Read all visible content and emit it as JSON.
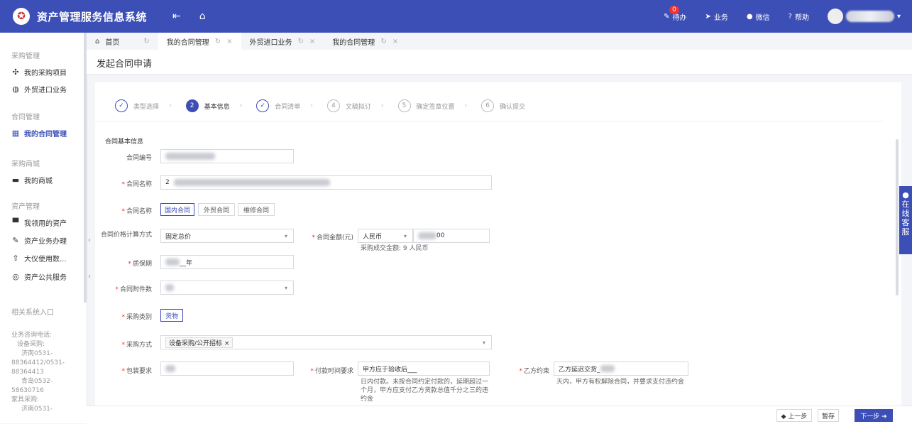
{
  "app": {
    "title": "资产管理服务信息系统"
  },
  "topbar": {
    "todo_label": "待办",
    "todo_count": "0",
    "business_label": "业务",
    "wechat_label": "微信",
    "help_label": "帮助"
  },
  "sidebar": {
    "groups": [
      {
        "label": "采购管理"
      },
      {
        "label": "合同管理"
      },
      {
        "label": "采购商城"
      },
      {
        "label": "资产管理"
      },
      {
        "label": "相关系统入口"
      }
    ],
    "items": [
      {
        "label": "我的采购项目"
      },
      {
        "label": "外贸进口业务"
      },
      {
        "label": "我的合同管理"
      },
      {
        "label": "我的商城"
      },
      {
        "label": "我领用的资产"
      },
      {
        "label": "资产业务办理"
      },
      {
        "label": "大仪使用数..."
      },
      {
        "label": "资产公共服务"
      }
    ],
    "footer_lines": [
      "业务咨询电话:",
      "设备采购:",
      "济南0531-",
      "88364412/0531-",
      "88364413",
      "青岛0532-",
      "58630716",
      "家具采购:",
      "济南0531-"
    ]
  },
  "tabs": [
    {
      "label": "首页"
    },
    {
      "label": "我的合同管理"
    },
    {
      "label": "外贸进口业务"
    },
    {
      "label": "我的合同管理"
    }
  ],
  "page": {
    "title": "发起合同申请"
  },
  "steps": [
    {
      "num": "✓",
      "label": "类型选择"
    },
    {
      "num": "2",
      "label": "基本信息"
    },
    {
      "num": "✓",
      "label": "合同清单"
    },
    {
      "num": "4",
      "label": "文稿拟订"
    },
    {
      "num": "5",
      "label": "确定签章位置"
    },
    {
      "num": "6",
      "label": "确认提交"
    }
  ],
  "form": {
    "section_title": "合同基本信息",
    "contract_no_label": "合同编号",
    "contract_name_label": "合同名称",
    "contract_name_prefix": "2",
    "category_label": "合同类别",
    "category_options": [
      "国内合同",
      "外贸合同",
      "维修合同"
    ],
    "price_method_label": "合同价格计算方式",
    "price_method_value": "固定总价",
    "amount_label": "合同金额(元)",
    "currency_value": "人民币",
    "amount_value": "00",
    "amount_hint": "采购成交金额: 9        人民币",
    "warranty_label": "质保期",
    "warranty_value": "__年",
    "attachments_label": "合同附件数",
    "purchase_type_label": "采购类别",
    "purchase_type_value": "货物",
    "purchase_method_label": "采购方式",
    "purchase_method_tag": "设备采购/公开招标 ×",
    "packing_label": "包装要求",
    "payment_time_label": "付款时间要求",
    "payment_time_value": "甲方应于验收后___",
    "payment_hint": "日内付款。未按合同约定付款的，延期超过一个月，甲方应支付乙方货款总值千分之三的违约金",
    "partyb_label": "乙方约束",
    "partyb_value": "乙方延迟交货_",
    "partyb_hint": "天内，甲方有权解除合同，并要求支付违约金"
  },
  "footer": {
    "prev_label": "◆ 上一步",
    "save_label": "暂存",
    "next_label": "下一步 ➔"
  },
  "side_chat": {
    "label": "在线客服"
  }
}
